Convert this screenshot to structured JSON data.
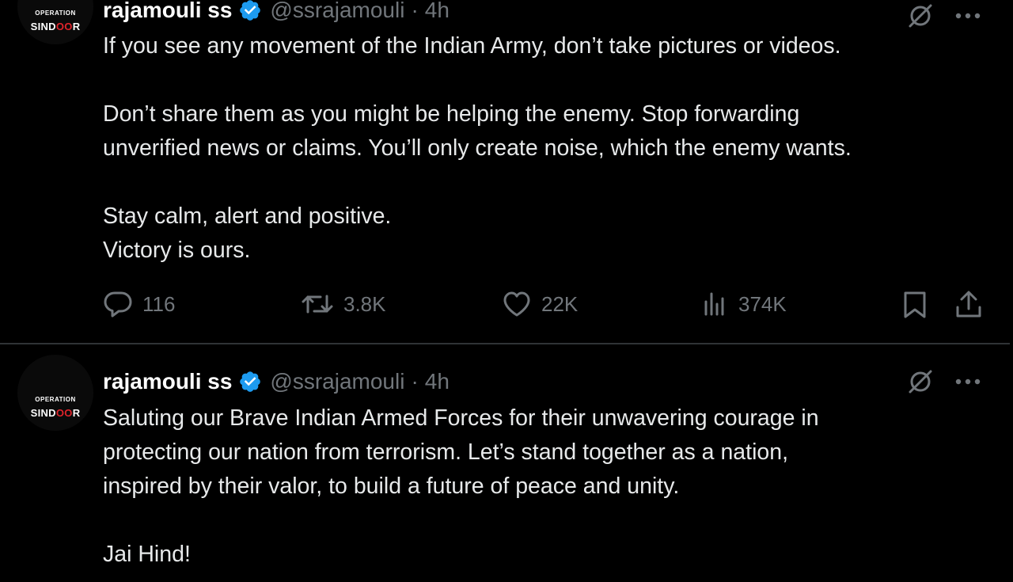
{
  "tweets": [
    {
      "avatar": {
        "line1": "OPERATION",
        "line2_a": "SIND",
        "line2_mark": "OO",
        "line2_b": "R"
      },
      "name": "rajamouli ss",
      "handle": "@ssrajamouli",
      "separator": "·",
      "time": "4h",
      "lines": [
        "If you see any movement of the Indian Army, don’t take pictures or videos.",
        "",
        "Don’t share them as you might be helping the enemy. Stop forwarding",
        "unverified news or claims. You’ll only create noise, which the enemy wants.",
        "",
        "Stay calm, alert and positive.",
        "Victory is ours."
      ],
      "stats": {
        "replies": "116",
        "reposts": "3.8K",
        "likes": "22K",
        "views": "374K"
      }
    },
    {
      "avatar": {
        "line1": "OPERATION",
        "line2_a": "SIND",
        "line2_mark": "OO",
        "line2_b": "R"
      },
      "name": "rajamouli ss",
      "handle": "@ssrajamouli",
      "separator": "·",
      "time": "4h",
      "lines": [
        "Saluting our Brave Indian Armed Forces for their unwavering courage in",
        "protecting our nation from terrorism. Let’s stand together as a nation,",
        "inspired by their valor, to build a future of peace and unity.",
        "",
        "Jai Hind!"
      ]
    }
  ],
  "icons": {
    "verified": "verified-badge-icon",
    "grok": "grok-icon",
    "more": "more-icon",
    "reply": "reply-icon",
    "repost": "repost-icon",
    "like": "like-icon",
    "views": "views-icon",
    "bookmark": "bookmark-icon",
    "share": "share-icon",
    "flag": "india-flag-emoji"
  },
  "colors": {
    "background": "#000000",
    "text": "#e7e9ea",
    "muted": "#71767b",
    "verified": "#1d9bf0",
    "divider": "#2f3336"
  }
}
